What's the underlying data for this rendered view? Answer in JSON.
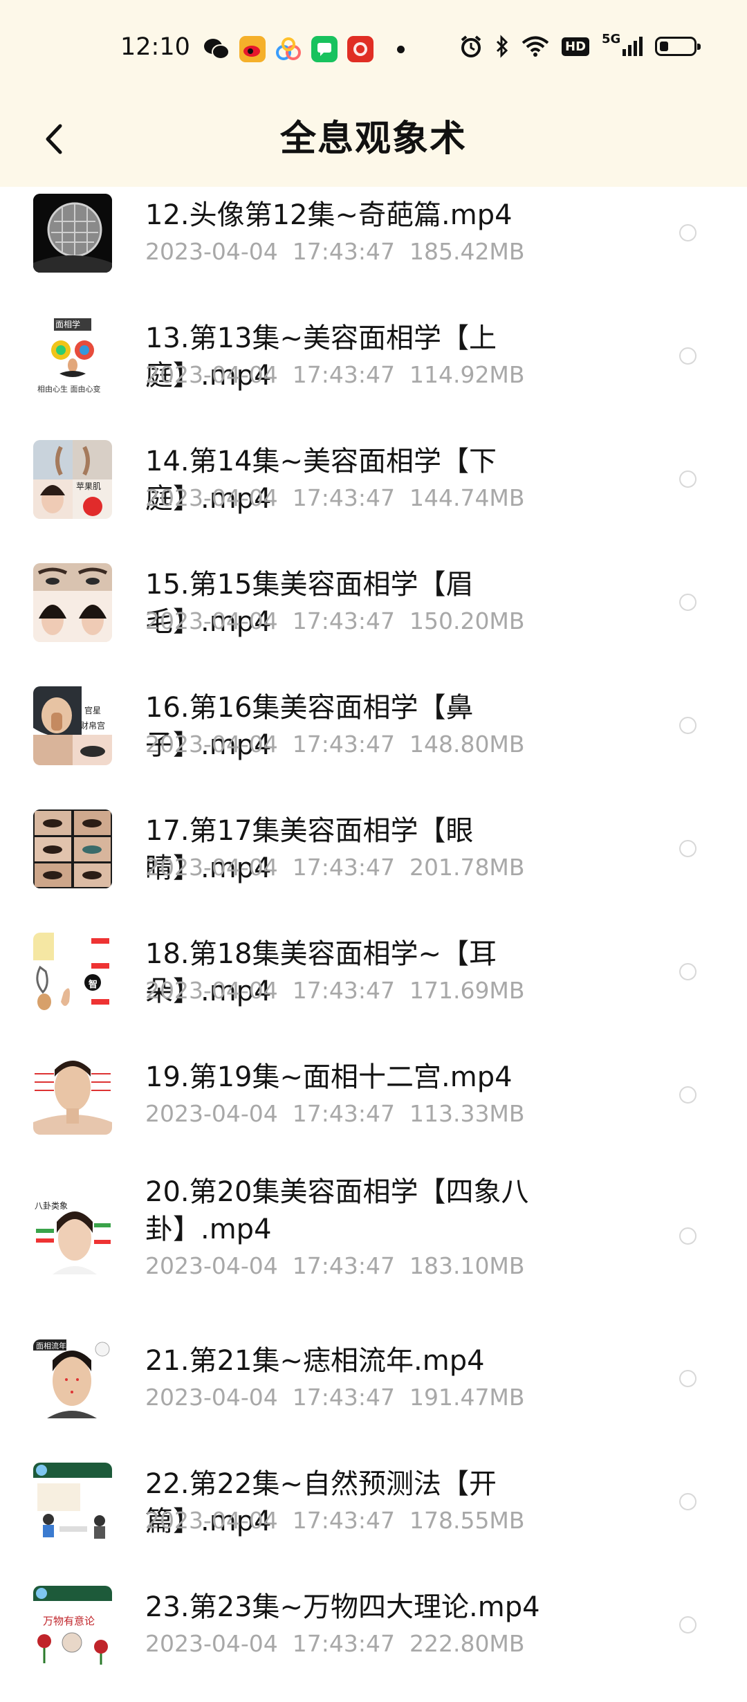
{
  "status_bar": {
    "time": "12:10",
    "left_icons": [
      {
        "name": "wechat-icon",
        "color": "#2dc100"
      },
      {
        "name": "weibo-icon",
        "color": "#f5b02a"
      },
      {
        "name": "baidu-netdisk-icon",
        "color": "#3a9dfc"
      },
      {
        "name": "message-icon",
        "color": "#18c25e"
      },
      {
        "name": "pinduoduo-icon",
        "color": "#e02e24"
      }
    ],
    "right_icons": [
      "alarm-icon",
      "bluetooth-icon",
      "wifi-icon",
      "hd-icon",
      "signal-5g-icon",
      "battery-icon"
    ],
    "hd_label": "HD",
    "net_label": "5G"
  },
  "header": {
    "title": "全息观象术"
  },
  "files": [
    {
      "name": "12.头像第12集~奇葩篇.mp4",
      "date": "2023-04-04",
      "time": "17:43:47",
      "size": "185.42MB"
    },
    {
      "name": "13.第13集~美容面相学【上庭】.mp4",
      "date": "2023-04-04",
      "time": "17:43:47",
      "size": "114.92MB",
      "thumb_text": "面相学",
      "thumb_caption": "相由心生 面由心变"
    },
    {
      "name": "14.第14集~美容面相学【下庭】.mp4",
      "date": "2023-04-04",
      "time": "17:43:47",
      "size": "144.74MB",
      "thumb_text": "苹果肌"
    },
    {
      "name": "15.第15集美容面相学【眉毛】.mp4",
      "date": "2023-04-04",
      "time": "17:43:47",
      "size": "150.20MB"
    },
    {
      "name": "16.第16集美容面相学【鼻子】.mp4",
      "date": "2023-04-04",
      "time": "17:43:47",
      "size": "148.80MB",
      "thumb_text": "官星",
      "thumb_caption": "财帛宫"
    },
    {
      "name": "17.第17集美容面相学【眼睛】.mp4",
      "date": "2023-04-04",
      "time": "17:43:47",
      "size": "201.78MB"
    },
    {
      "name": "18.第18集美容面相学~【耳朵】.mp4",
      "date": "2023-04-04",
      "time": "17:43:47",
      "size": "171.69MB",
      "thumb_text": "智"
    },
    {
      "name": "19.第19集~面相十二宫.mp4",
      "date": "2023-04-04",
      "time": "17:43:47",
      "size": "113.33MB"
    },
    {
      "name": "20.第20集美容面相学【四象八卦】.mp4",
      "date": "2023-04-04",
      "time": "17:43:47",
      "size": "183.10MB",
      "thumb_text": "八卦类象"
    },
    {
      "name": "21.第21集~痣相流年.mp4",
      "date": "2023-04-04",
      "time": "17:43:47",
      "size": "191.47MB",
      "thumb_text": "面相流年"
    },
    {
      "name": "22.第22集~自然预测法【开篇】.mp4",
      "date": "2023-04-04",
      "time": "17:43:47",
      "size": "178.55MB"
    },
    {
      "name": "23.第23集~万物四大理论.mp4",
      "date": "2023-04-04",
      "time": "17:43:47",
      "size": "222.80MB",
      "thumb_text": "万物有意论"
    }
  ]
}
